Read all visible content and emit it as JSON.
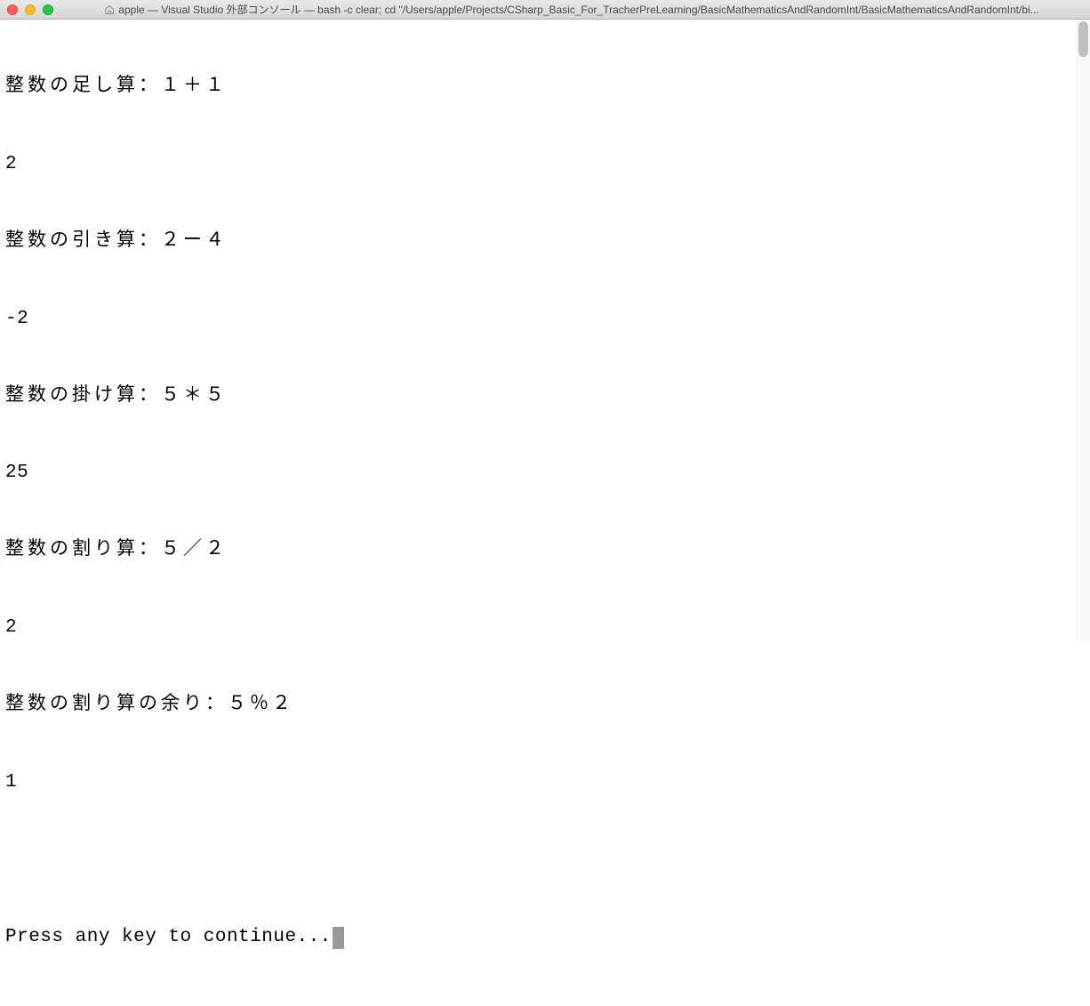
{
  "window": {
    "title": "apple — Visual Studio 外部コンソール — bash -c clear; cd \"/Users/apple/Projects/CSharp_Basic_For_TracherPreLearning/BasicMathematicsAndRandomInt/BasicMathematicsAndRandomInt/bi..."
  },
  "terminal": {
    "lines": [
      "整数の足し算：１＋１",
      "2",
      "整数の引き算：２ー４",
      "-2",
      "整数の掛け算：５＊５",
      "25",
      "整数の割り算：５／２",
      "2",
      "整数の割り算の余り：５％２",
      "1"
    ],
    "prompt": "Press any key to continue..."
  }
}
